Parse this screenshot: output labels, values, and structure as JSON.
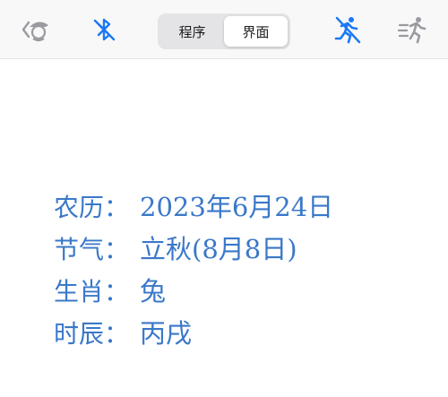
{
  "toolbar": {
    "segments": [
      {
        "label": "程序",
        "active": false
      },
      {
        "label": "界面",
        "active": true
      }
    ],
    "accent": "#1a78f5",
    "icons": {
      "left_1": "hat-hero-icon",
      "left_2": "bluetooth-off-icon",
      "right_1": "running-off-icon",
      "right_2": "speed-running-icon"
    }
  },
  "info": {
    "separator": "：",
    "rows": [
      {
        "label": "农历",
        "value": "2023年6月24日"
      },
      {
        "label": "节气",
        "value": "立秋(8月8日)"
      },
      {
        "label": "生肖",
        "value": "兔"
      },
      {
        "label": "时辰",
        "value": "丙戌"
      }
    ],
    "text_color": "#3a78c9"
  }
}
